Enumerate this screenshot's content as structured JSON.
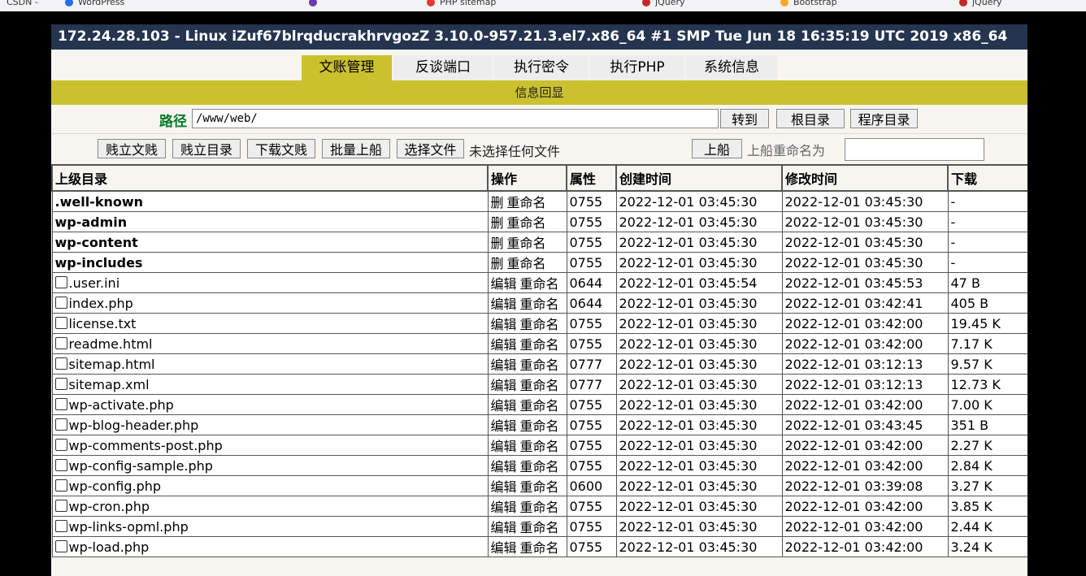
{
  "server_title": "172.24.28.103 - Linux iZuf67blrqducrakhrvgozZ 3.10.0-957.21.3.el7.x86_64 #1 SMP Tue Jun 18 16:35:19 UTC 2019 x86_64",
  "tabs": [
    "文账管理",
    "反谈端口",
    "执行密令",
    "执行PHP",
    "系统信息"
  ],
  "active_tab": 0,
  "info_bar": "信息回显",
  "path": {
    "label": "路径",
    "value": "/www/web/"
  },
  "path_buttons": [
    "转到",
    "根目录",
    "程序目录"
  ],
  "toolbar": {
    "buttons": [
      "贱立文贱",
      "贱立目录",
      "下载文贱",
      "批量上船"
    ],
    "choose_file": "选择文件",
    "no_file": "未选择任何文件",
    "upload": "上船",
    "rename_label": "上船重命名为"
  },
  "table": {
    "headers": [
      "上级目录",
      "操作",
      "属性",
      "创建时间",
      "修改时间",
      "下载"
    ],
    "dir_actions": [
      "删",
      "重命名"
    ],
    "file_actions": [
      "编辑",
      "重命名"
    ],
    "rows": [
      {
        "name": ".well-known",
        "type": "dir",
        "perm": "0755",
        "created": "2022-12-01 03:45:30",
        "modified": "2022-12-01 03:45:30",
        "size": "-"
      },
      {
        "name": "wp-admin",
        "type": "dir",
        "perm": "0755",
        "created": "2022-12-01 03:45:30",
        "modified": "2022-12-01 03:45:30",
        "size": "-"
      },
      {
        "name": "wp-content",
        "type": "dir",
        "perm": "0755",
        "created": "2022-12-01 03:45:30",
        "modified": "2022-12-01 03:45:30",
        "size": "-"
      },
      {
        "name": "wp-includes",
        "type": "dir",
        "perm": "0755",
        "created": "2022-12-01 03:45:30",
        "modified": "2022-12-01 03:45:30",
        "size": "-"
      },
      {
        "name": ".user.ini",
        "type": "file",
        "perm": "0644",
        "created": "2022-12-01 03:45:54",
        "modified": "2022-12-01 03:45:53",
        "size": "47 B"
      },
      {
        "name": "index.php",
        "type": "file",
        "perm": "0644",
        "created": "2022-12-01 03:45:30",
        "modified": "2022-12-01 03:42:41",
        "size": "405 B"
      },
      {
        "name": "license.txt",
        "type": "file",
        "perm": "0755",
        "created": "2022-12-01 03:45:30",
        "modified": "2022-12-01 03:42:00",
        "size": "19.45 K"
      },
      {
        "name": "readme.html",
        "type": "file",
        "perm": "0755",
        "created": "2022-12-01 03:45:30",
        "modified": "2022-12-01 03:42:00",
        "size": "7.17 K"
      },
      {
        "name": "sitemap.html",
        "type": "file",
        "perm": "0777",
        "created": "2022-12-01 03:45:30",
        "modified": "2022-12-01 03:12:13",
        "size": "9.57 K"
      },
      {
        "name": "sitemap.xml",
        "type": "file",
        "perm": "0777",
        "created": "2022-12-01 03:45:30",
        "modified": "2022-12-01 03:12:13",
        "size": "12.73 K"
      },
      {
        "name": "wp-activate.php",
        "type": "file",
        "perm": "0755",
        "created": "2022-12-01 03:45:30",
        "modified": "2022-12-01 03:42:00",
        "size": "7.00 K"
      },
      {
        "name": "wp-blog-header.php",
        "type": "file",
        "perm": "0755",
        "created": "2022-12-01 03:45:30",
        "modified": "2022-12-01 03:43:45",
        "size": "351 B"
      },
      {
        "name": "wp-comments-post.php",
        "type": "file",
        "perm": "0755",
        "created": "2022-12-01 03:45:30",
        "modified": "2022-12-01 03:42:00",
        "size": "2.27 K"
      },
      {
        "name": "wp-config-sample.php",
        "type": "file",
        "perm": "0755",
        "created": "2022-12-01 03:45:30",
        "modified": "2022-12-01 03:42:00",
        "size": "2.84 K"
      },
      {
        "name": "wp-config.php",
        "type": "file",
        "perm": "0600",
        "created": "2022-12-01 03:45:30",
        "modified": "2022-12-01 03:39:08",
        "size": "3.27 K"
      },
      {
        "name": "wp-cron.php",
        "type": "file",
        "perm": "0755",
        "created": "2022-12-01 03:45:30",
        "modified": "2022-12-01 03:42:00",
        "size": "3.85 K"
      },
      {
        "name": "wp-links-opml.php",
        "type": "file",
        "perm": "0755",
        "created": "2022-12-01 03:45:30",
        "modified": "2022-12-01 03:42:00",
        "size": "2.44 K"
      },
      {
        "name": "wp-load.php",
        "type": "file",
        "perm": "0755",
        "created": "2022-12-01 03:45:30",
        "modified": "2022-12-01 03:42:00",
        "size": "3.24 K"
      }
    ]
  }
}
